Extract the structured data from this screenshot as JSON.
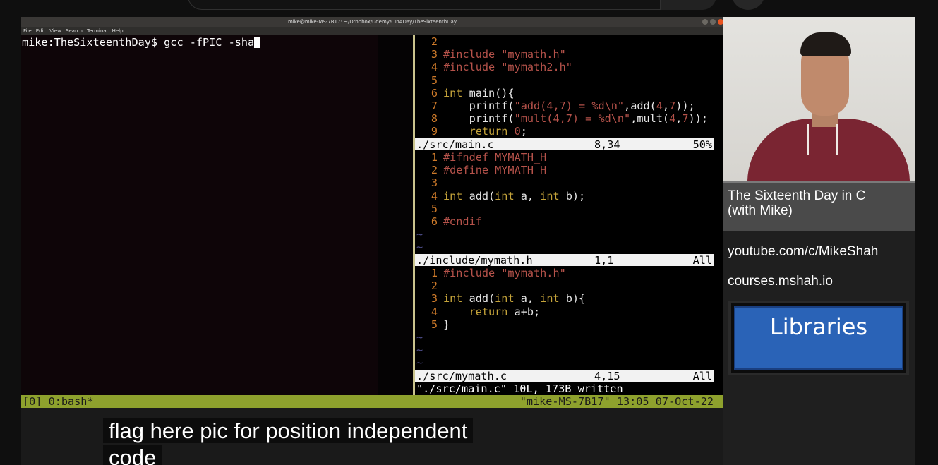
{
  "terminal": {
    "title": "mike@mike-MS-7B17: ~/Dropbox/Udemy/CInADay/TheSixteenthDay",
    "menu": [
      "File",
      "Edit",
      "View",
      "Search",
      "Terminal",
      "Help"
    ],
    "prompt": "mike:TheSixteenthDay$ gcc -fPIC -sha"
  },
  "vim": {
    "main_c": [
      {
        "n": "2",
        "code": ""
      },
      {
        "n": "3",
        "code": "#include \"mymath.h\""
      },
      {
        "n": "4",
        "code": "#include \"mymath2.h\""
      },
      {
        "n": "5",
        "code": ""
      },
      {
        "n": "6",
        "code": "int main(){"
      },
      {
        "n": "7",
        "code": "    printf(\"add(4,7) = %d\\n\",add(4,7));"
      },
      {
        "n": "8",
        "code": "    printf(\"mult(4,7) = %d\\n\",mult(4,7));"
      },
      {
        "n": "9",
        "code": "    return 0;"
      }
    ],
    "status1": {
      "file": "./src/main.c",
      "pos": "8,34",
      "pct": "50%"
    },
    "mymath_h": [
      {
        "n": "1",
        "code": "#ifndef MYMATH_H"
      },
      {
        "n": "2",
        "code": "#define MYMATH_H"
      },
      {
        "n": "3",
        "code": ""
      },
      {
        "n": "4",
        "code": "int add(int a, int b);"
      },
      {
        "n": "5",
        "code": ""
      },
      {
        "n": "6",
        "code": "#endif"
      }
    ],
    "status2": {
      "file": "./include/mymath.h",
      "pos": "1,1",
      "pct": "All"
    },
    "mymath_c": [
      {
        "n": "1",
        "code": "#include \"mymath.h\""
      },
      {
        "n": "2",
        "code": ""
      },
      {
        "n": "3",
        "code": "int add(int a, int b){"
      },
      {
        "n": "4",
        "code": "    return a+b;"
      },
      {
        "n": "5",
        "code": "}"
      }
    ],
    "status3": {
      "file": "./src/mymath.c",
      "pos": "4,15",
      "pct": "All"
    },
    "cmdline": "\"./src/main.c\" 10L, 173B written",
    "tilde": "~"
  },
  "tmux": {
    "left": "[0] 0:bash*",
    "right": "\"mike-MS-7B17\" 13:05 07-Oct-22"
  },
  "side": {
    "title": "The Sixteenth Day in C\n(with Mike)",
    "link1": "youtube.com/c/MikeShah",
    "link2": "courses.mshah.io",
    "topic": "Libraries"
  },
  "caption": {
    "line1": "flag here pic for position independent",
    "line2": "code"
  }
}
